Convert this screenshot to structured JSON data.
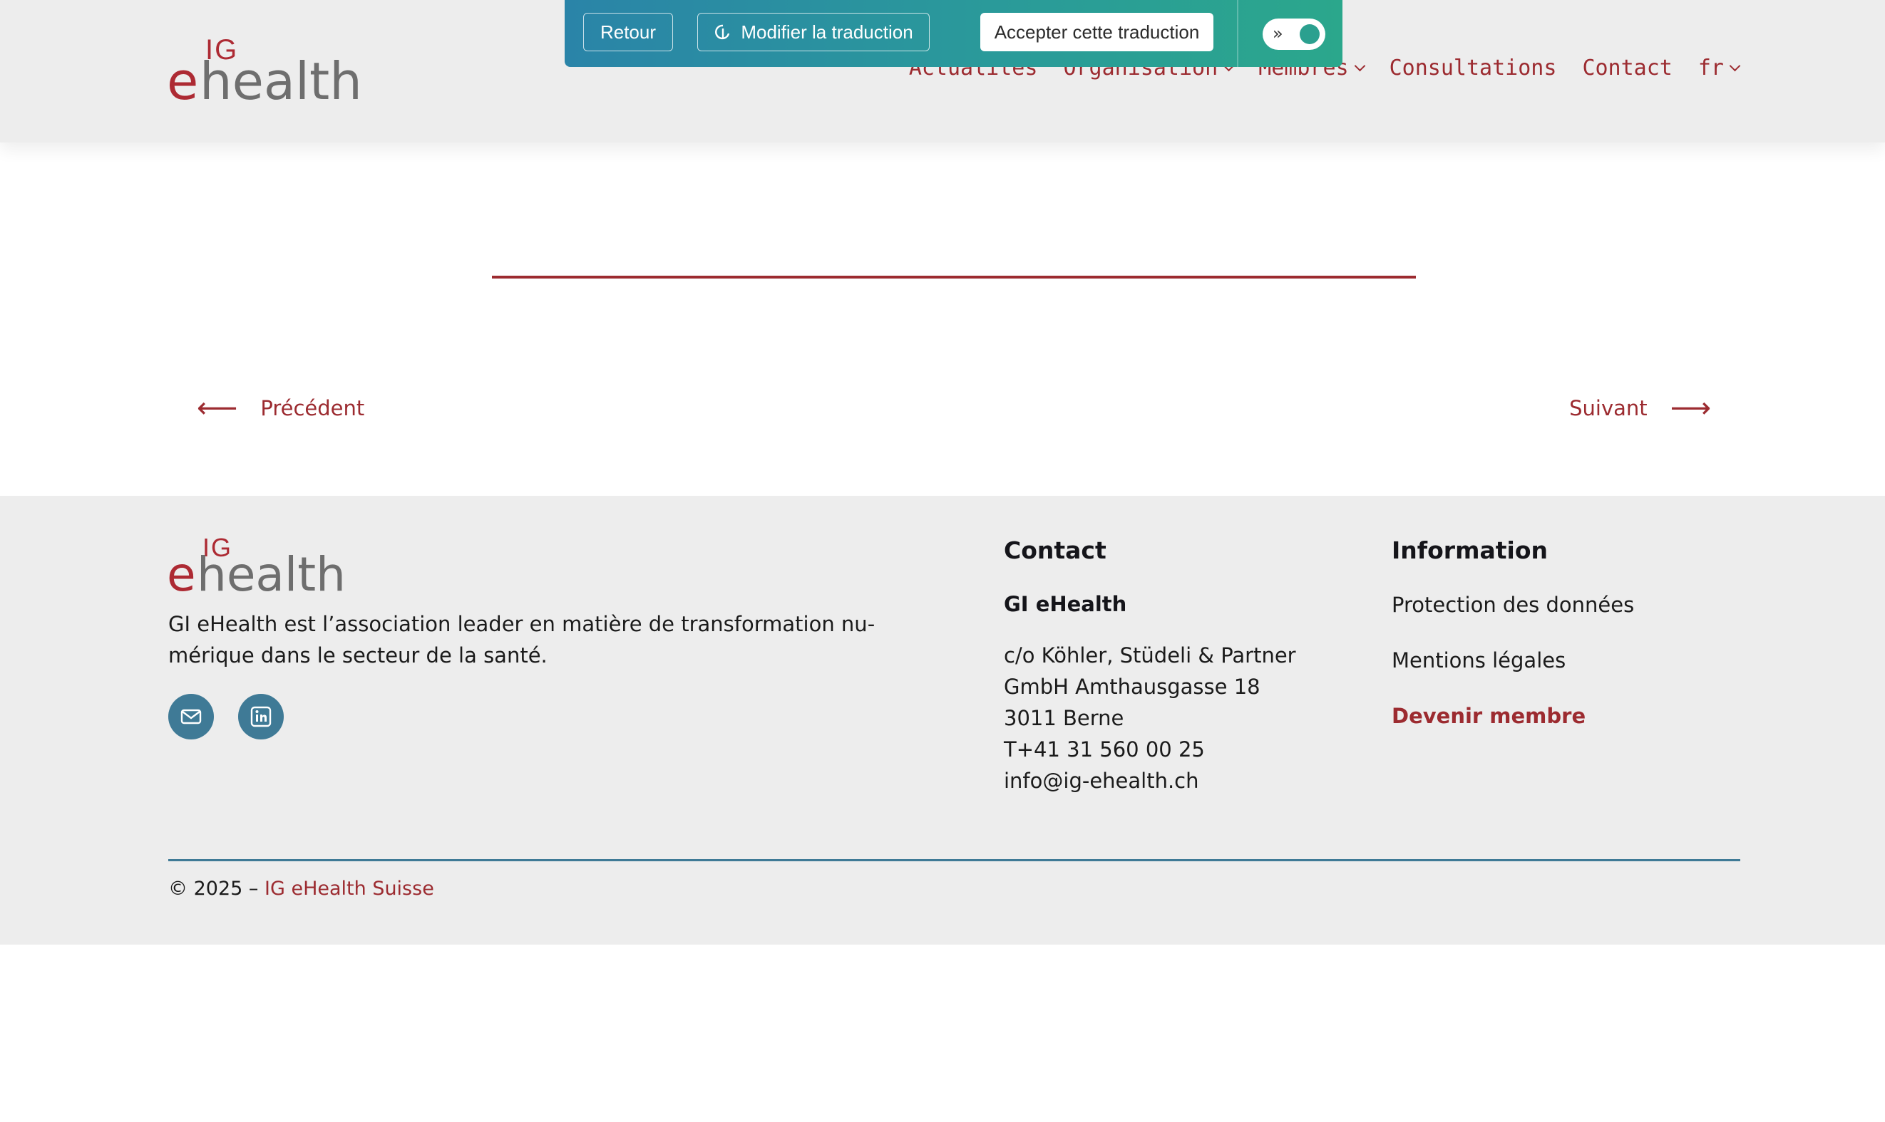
{
  "header": {
    "logo": {
      "ig": "IG",
      "e": "e",
      "rest": "health"
    },
    "nav": [
      {
        "label": "Actualités",
        "dropdown": false
      },
      {
        "label": "Organisation",
        "dropdown": true
      },
      {
        "label": "Membres",
        "dropdown": true
      },
      {
        "label": "Consultations",
        "dropdown": false
      },
      {
        "label": "Contact",
        "dropdown": false
      },
      {
        "label": "fr",
        "dropdown": true
      }
    ]
  },
  "translation_toolbar": {
    "back_label": "Retour",
    "edit_label": "Modifier la traduction",
    "accept_label": "Accepter cette traduction",
    "toggle_on": true
  },
  "pager": {
    "prev_label": "Précédent",
    "next_label": "Suivant",
    "prev_arrow": "⟵",
    "next_arrow": "⟶"
  },
  "footer": {
    "logo": {
      "ig": "IG",
      "e": "e",
      "rest": "health"
    },
    "description_line1": "GI eHealth est l’association leader en matière de transformation nu-",
    "description_line2": "mérique dans le secteur de la santé.",
    "social": [
      "mail-icon",
      "linkedin-icon"
    ],
    "contact": {
      "title": "Contact",
      "org": "GI eHealth",
      "address": [
        "c/o Köhler, Stüdeli & Partner",
        "GmbH Amthausgasse 18",
        "3011 Berne",
        "T+41 31 560 00 25",
        "info@ig-ehealth.ch"
      ]
    },
    "information": {
      "title": "Information",
      "links": [
        "Protection des données",
        "Mentions légales",
        "Devenir membre"
      ]
    },
    "copyright_prefix": "© 2025 –",
    "copyright_link": "IG eHealth Suisse"
  },
  "colors": {
    "brand_red": "#9c2b30",
    "teal_blue": "#3f7a96",
    "header_bg": "#ededed"
  }
}
